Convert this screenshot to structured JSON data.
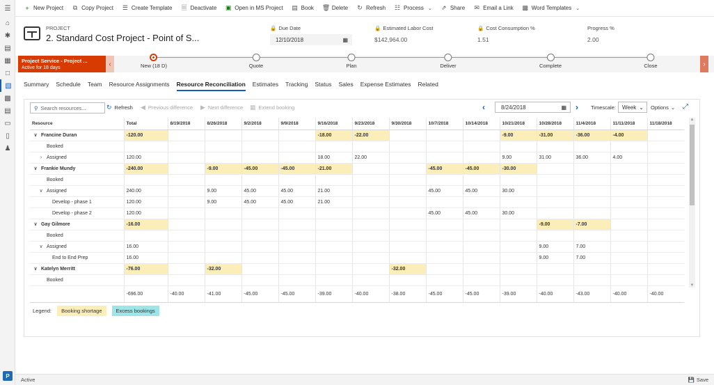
{
  "rail": {
    "items": [
      "home",
      "recent",
      "pinned",
      "projects",
      "documents",
      "resource-reconciliation",
      "calendar",
      "schedule",
      "time-entries",
      "expenses",
      "people"
    ],
    "badge": "P"
  },
  "commandbar": {
    "new_project": "New Project",
    "copy_project": "Copy Project",
    "create_template": "Create Template",
    "deactivate": "Deactivate",
    "open_ms_project": "Open in MS Project",
    "book": "Book",
    "delete": "Delete",
    "refresh": "Refresh",
    "process": "Process",
    "share": "Share",
    "email_link": "Email a Link",
    "word_templates": "Word Templates"
  },
  "header": {
    "entity_type": "PROJECT",
    "name": "2. Standard Cost Project - Point of S...",
    "due_date_label": "Due Date",
    "due_date": "12/10/2018",
    "labor_cost_label": "Estimated Labor Cost",
    "labor_cost": "$142,964.00",
    "cost_consumption_label": "Cost Consumption %",
    "cost_consumption": "1.51",
    "progress_label": "Progress %",
    "progress": "2.00"
  },
  "bpf": {
    "active_title": "Project Service - Project ...",
    "active_sub": "Active for 18 days",
    "stages": [
      "New  (18 D)",
      "Quote",
      "Plan",
      "Deliver",
      "Complete",
      "Close"
    ]
  },
  "tabs": [
    "Summary",
    "Schedule",
    "Team",
    "Resource Assignments",
    "Resource Reconciliation",
    "Estimates",
    "Tracking",
    "Status",
    "Sales",
    "Expense Estimates",
    "Related"
  ],
  "toolbar": {
    "search_placeholder": "Search resources...",
    "refresh": "Refresh",
    "prev": "Previous difference",
    "next": "Next difference",
    "extend": "Extend booking",
    "date": "8/24/2018",
    "timescale_label": "Timescale:",
    "timescale": "Week",
    "options": "Options"
  },
  "grid": {
    "columns": [
      "Resource",
      "Total",
      "8/19/2018",
      "8/26/2018",
      "9/2/2018",
      "9/9/2018",
      "9/16/2018",
      "9/23/2018",
      "9/30/2018",
      "10/7/2018",
      "10/14/2018",
      "10/21/2018",
      "10/28/2018",
      "11/4/2018",
      "11/11/2018",
      "11/18/2018"
    ],
    "rows": [
      {
        "label": "Francine Duran",
        "level": 0,
        "caret": "down",
        "cells": [
          "-120.00",
          "",
          "",
          "",
          "",
          "-18.00",
          "-22.00",
          "",
          "",
          "",
          "-9.00",
          "-31.00",
          "-36.00",
          "-4.00",
          ""
        ],
        "short": [
          0,
          5,
          6,
          10,
          11,
          12,
          13
        ]
      },
      {
        "label": "Booked",
        "level": 1,
        "caret": "",
        "cells": [
          "",
          "",
          "",
          "",
          "",
          "",
          "",
          "",
          "",
          "",
          "",
          "",
          "",
          "",
          ""
        ],
        "short": []
      },
      {
        "label": "Assigned",
        "level": 1,
        "caret": "right",
        "cells": [
          "120.00",
          "",
          "",
          "",
          "",
          "18.00",
          "22.00",
          "",
          "",
          "",
          "9.00",
          "31.00",
          "36.00",
          "4.00",
          ""
        ],
        "short": []
      },
      {
        "label": "Frankie Mundy",
        "level": 0,
        "caret": "down",
        "cells": [
          "-240.00",
          "",
          "-9.00",
          "-45.00",
          "-45.00",
          "-21.00",
          "",
          "",
          "-45.00",
          "-45.00",
          "-30.00",
          "",
          "",
          "",
          ""
        ],
        "short": [
          0,
          2,
          3,
          4,
          5,
          8,
          9,
          10
        ]
      },
      {
        "label": "Booked",
        "level": 1,
        "caret": "",
        "cells": [
          "",
          "",
          "",
          "",
          "",
          "",
          "",
          "",
          "",
          "",
          "",
          "",
          "",
          "",
          ""
        ],
        "short": []
      },
      {
        "label": "Assigned",
        "level": 1,
        "caret": "down",
        "cells": [
          "240.00",
          "",
          "9.00",
          "45.00",
          "45.00",
          "21.00",
          "",
          "",
          "45.00",
          "45.00",
          "30.00",
          "",
          "",
          "",
          ""
        ],
        "short": []
      },
      {
        "label": "Develop - phase 1",
        "level": 2,
        "caret": "",
        "cells": [
          "120.00",
          "",
          "9.00",
          "45.00",
          "45.00",
          "21.00",
          "",
          "",
          "",
          "",
          "",
          "",
          "",
          "",
          ""
        ],
        "short": []
      },
      {
        "label": "Develop - phase 2",
        "level": 2,
        "caret": "",
        "cells": [
          "120.00",
          "",
          "",
          "",
          "",
          "",
          "",
          "",
          "45.00",
          "45.00",
          "30.00",
          "",
          "",
          "",
          ""
        ],
        "short": []
      },
      {
        "label": "Gay Gilmore",
        "level": 0,
        "caret": "down",
        "cells": [
          "-16.00",
          "",
          "",
          "",
          "",
          "",
          "",
          "",
          "",
          "",
          "",
          "-9.00",
          "-7.00",
          "",
          ""
        ],
        "short": [
          0,
          11,
          12
        ]
      },
      {
        "label": "Booked",
        "level": 1,
        "caret": "",
        "cells": [
          "",
          "",
          "",
          "",
          "",
          "",
          "",
          "",
          "",
          "",
          "",
          "",
          "",
          "",
          ""
        ],
        "short": []
      },
      {
        "label": "Assigned",
        "level": 1,
        "caret": "down",
        "cells": [
          "16.00",
          "",
          "",
          "",
          "",
          "",
          "",
          "",
          "",
          "",
          "",
          "9.00",
          "7.00",
          "",
          ""
        ],
        "short": []
      },
      {
        "label": "End to End Prep",
        "level": 2,
        "caret": "",
        "cells": [
          "16.00",
          "",
          "",
          "",
          "",
          "",
          "",
          "",
          "",
          "",
          "",
          "9.00",
          "7.00",
          "",
          ""
        ],
        "short": []
      },
      {
        "label": "Katelyn Merritt",
        "level": 0,
        "caret": "down",
        "cells": [
          "-76.00",
          "",
          "-32.00",
          "",
          "",
          "",
          "",
          "-32.00",
          "",
          "",
          "",
          "",
          "",
          "",
          ""
        ],
        "short": [
          0,
          2,
          7
        ]
      },
      {
        "label": "Booked",
        "level": 1,
        "caret": "",
        "cells": [
          "",
          "",
          "",
          "",
          "",
          "",
          "",
          "",
          "",
          "",
          "",
          "",
          "",
          "",
          ""
        ],
        "short": []
      }
    ],
    "totals": [
      "-696.00",
      "-40.00",
      "-41.00",
      "-45.00",
      "-45.00",
      "-39.00",
      "-40.00",
      "-38.00",
      "-45.00",
      "-45.00",
      "-39.00",
      "-40.00",
      "-43.00",
      "-40.00",
      "-40.00"
    ]
  },
  "legend": {
    "label": "Legend:",
    "shortage": "Booking shortage",
    "excess": "Excess bookings"
  },
  "statusbar": {
    "status": "Active",
    "save": "Save"
  },
  "colors": {
    "accent": "#1160b7",
    "stage_active": "#d83b01",
    "shortage": "#fbeeb8",
    "excess": "#9ee5ea"
  }
}
